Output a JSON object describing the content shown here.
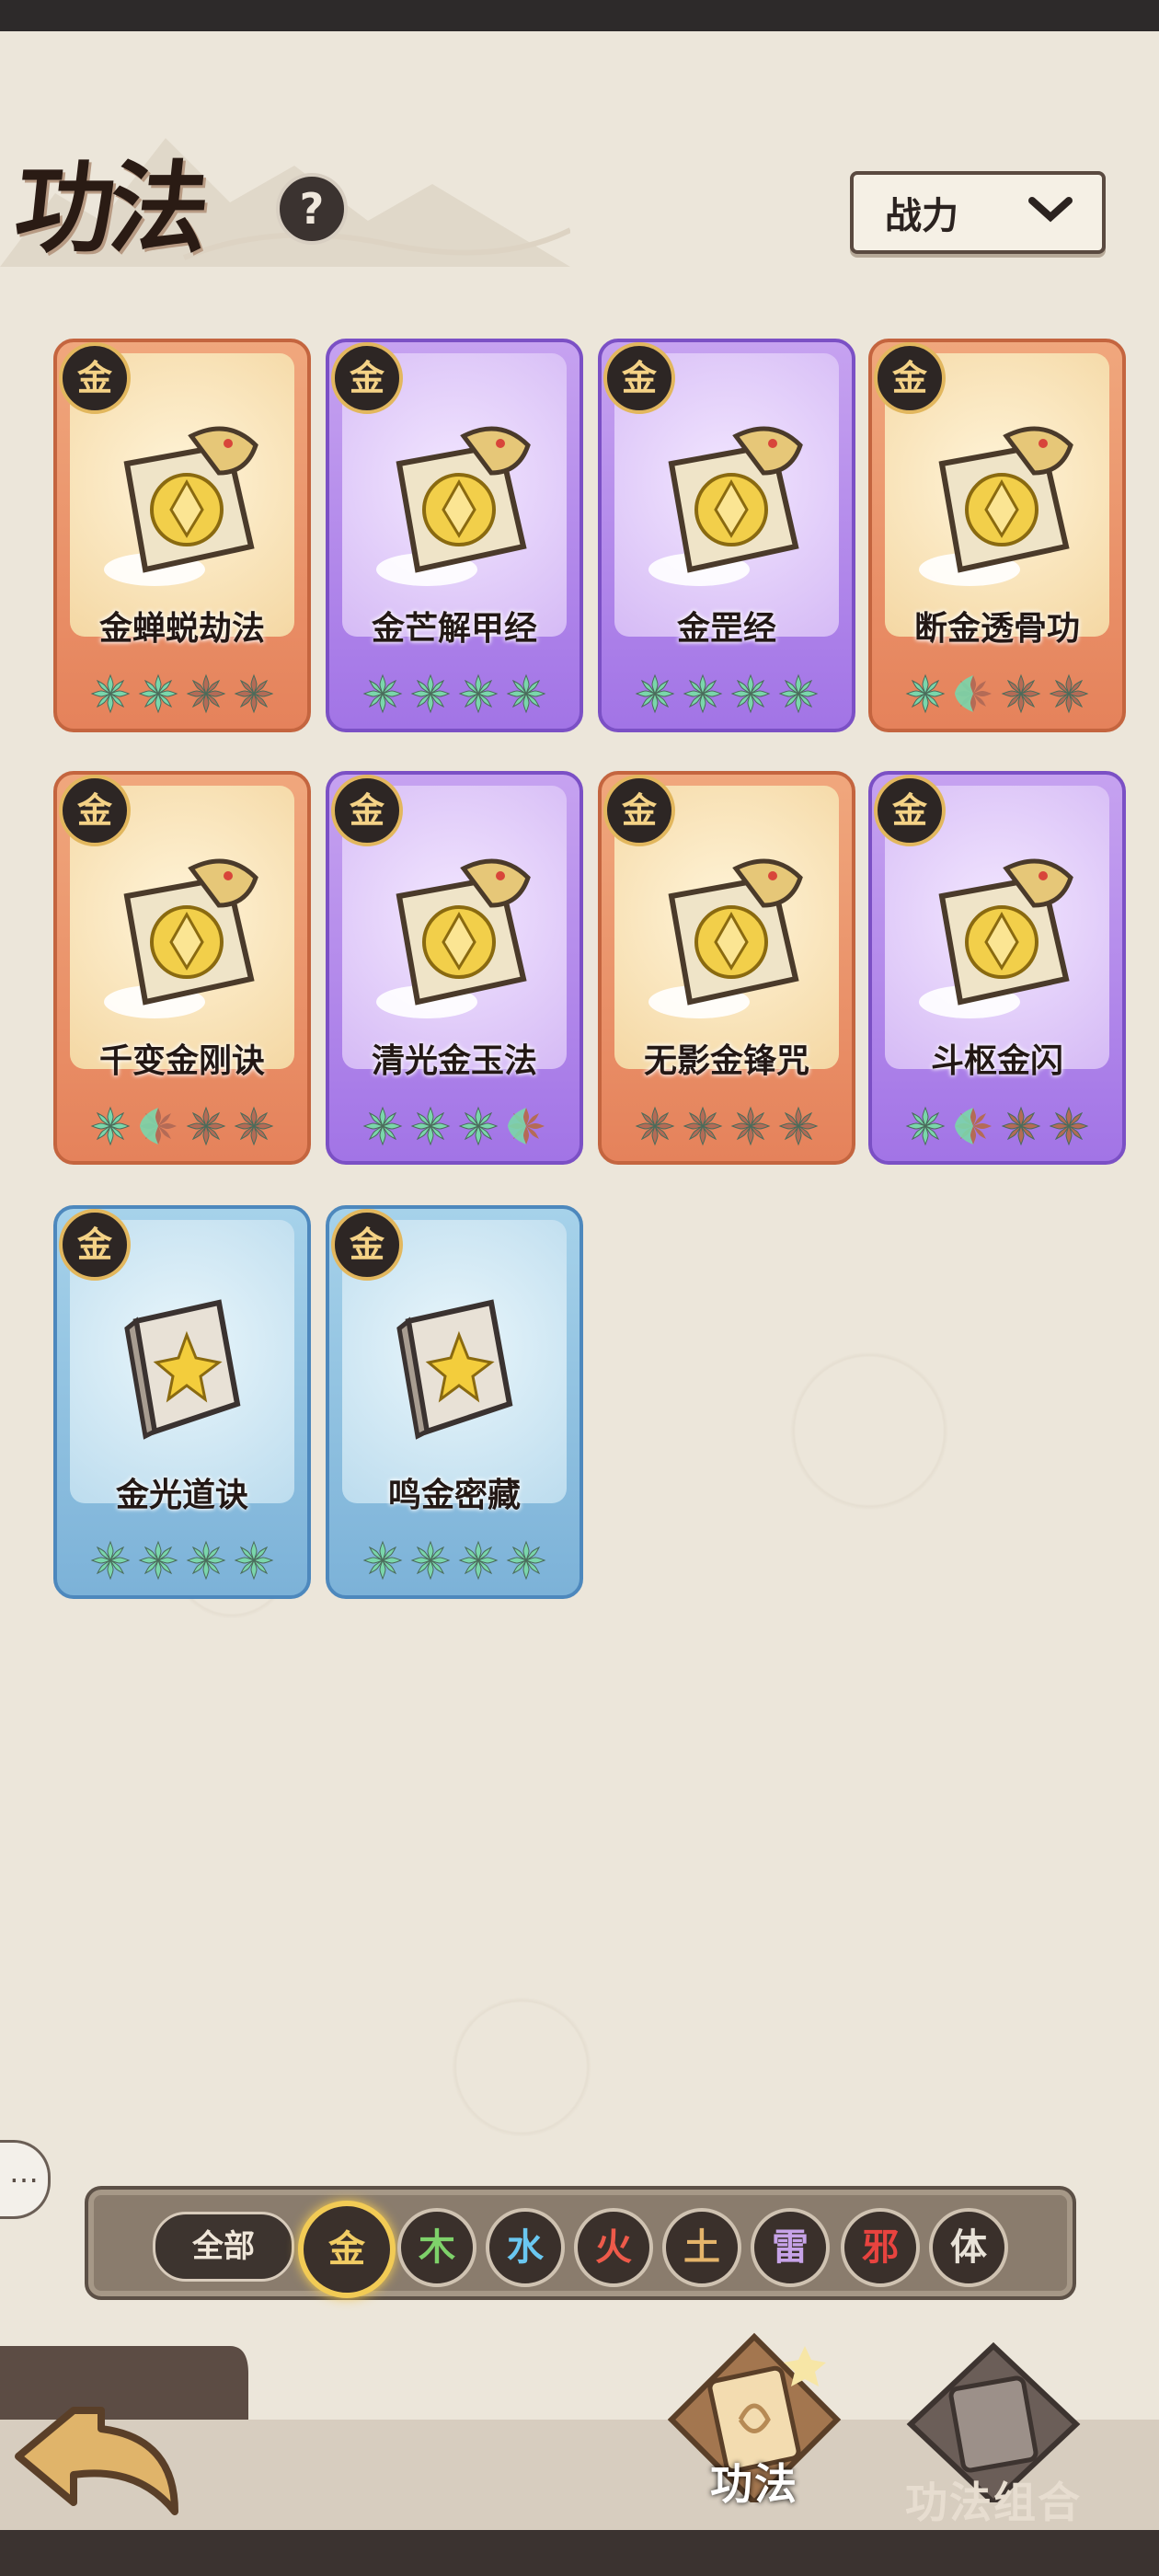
{
  "header": {
    "title": "功法",
    "help_icon": "question-icon",
    "sort": {
      "label": "战力",
      "icon": "chevron-down-icon"
    }
  },
  "cards": [
    {
      "name": "金蝉蜕劫法",
      "badge": "金",
      "rarity": "orange",
      "stars_filled": 2,
      "stars_total": 4,
      "icon": "cicada-scroll-icon"
    },
    {
      "name": "金芒解甲经",
      "badge": "金",
      "rarity": "purple",
      "stars_filled": 4,
      "stars_total": 4,
      "icon": "sword-scroll-icon"
    },
    {
      "name": "金罡经",
      "badge": "金",
      "rarity": "purple",
      "stars_filled": 4,
      "stars_total": 4,
      "icon": "arrow-up-scroll-icon"
    },
    {
      "name": "断金透骨功",
      "badge": "金",
      "rarity": "orange",
      "stars_filled": 1.5,
      "stars_total": 4,
      "icon": "fist-scroll-icon"
    },
    {
      "name": "千变金刚诀",
      "badge": "金",
      "rarity": "orange",
      "stars_filled": 1.5,
      "stars_total": 4,
      "icon": "leaf-scroll-icon"
    },
    {
      "name": "清光金玉法",
      "badge": "金",
      "rarity": "purple",
      "stars_filled": 3.5,
      "stars_total": 4,
      "icon": "jade-scroll-icon"
    },
    {
      "name": "无影金锋咒",
      "badge": "金",
      "rarity": "orange",
      "stars_filled": 0,
      "stars_total": 4,
      "icon": "blade-scroll-icon"
    },
    {
      "name": "斗枢金闪",
      "badge": "金",
      "rarity": "purple",
      "stars_filled": 1.5,
      "stars_total": 4,
      "icon": "flash-scroll-icon"
    },
    {
      "name": "金光道诀",
      "badge": "金",
      "rarity": "blue",
      "stars_filled": 4,
      "stars_total": 4,
      "icon": "book-star-icon"
    },
    {
      "name": "鸣金密藏",
      "badge": "金",
      "rarity": "blue",
      "stars_filled": 4,
      "stars_total": 4,
      "icon": "book-shield-icon"
    }
  ],
  "filters": {
    "all_label": "全部",
    "active": "金",
    "elements": [
      {
        "label": "金",
        "color": "#f1cc64"
      },
      {
        "label": "木",
        "color": "#7ed26a"
      },
      {
        "label": "水",
        "color": "#6ac7f0"
      },
      {
        "label": "火",
        "color": "#ee5a4a"
      },
      {
        "label": "土",
        "color": "#e4b46a"
      },
      {
        "label": "雷",
        "color": "#c7a3e8"
      },
      {
        "label": "邪",
        "color": "#e8433f"
      },
      {
        "label": "体",
        "color": "#e8e2d8"
      }
    ]
  },
  "bottom_nav": {
    "back_icon": "back-arrow-icon",
    "tabs": [
      {
        "label": "功法",
        "active": true,
        "icon": "scroll-book-icon"
      },
      {
        "label": "功法组合",
        "active": false,
        "icon": "combo-book-icon"
      }
    ]
  },
  "colors": {
    "star_filled": "#7ad6ab",
    "star_empty": "#b46b56",
    "gold": "#f1cc64"
  }
}
